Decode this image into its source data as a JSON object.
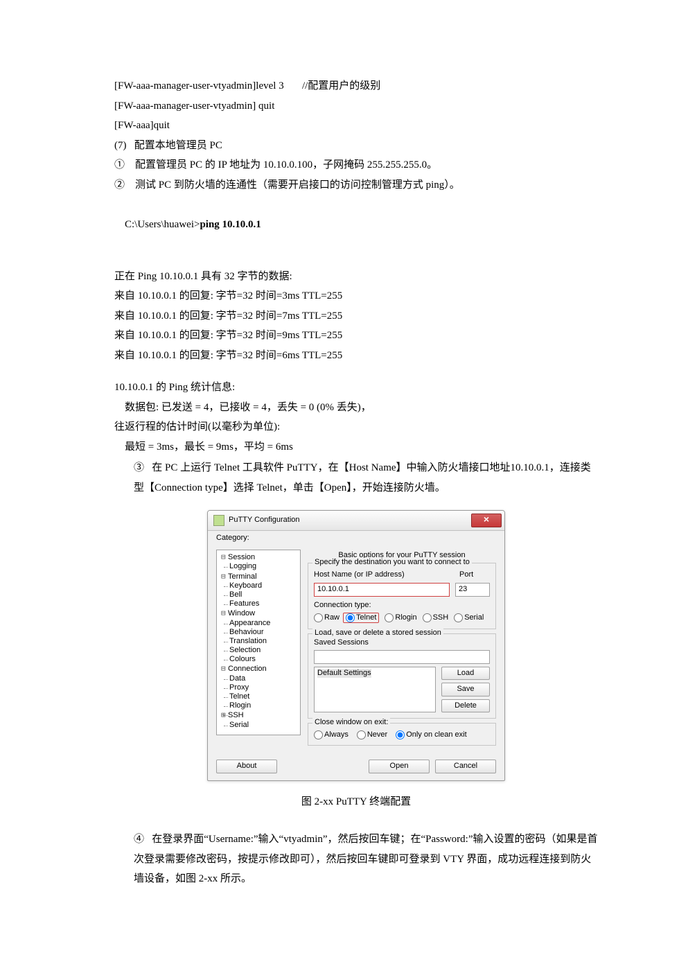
{
  "config_lines": {
    "l1": "[FW-aaa-manager-user-vtyadmin]level 3       //配置用户的级别",
    "l2": "[FW-aaa-manager-user-vtyadmin] quit",
    "l3": "[FW-aaa]quit"
  },
  "step7_heading": "(7)   配置本地管理员 PC",
  "step7_1": "①    配置管理员 PC 的 IP 地址为 10.10.0.100，子网掩码 255.255.255.0。",
  "step7_2": "②    测试 PC 到防火墙的连通性（需要开启接口的访问控制管理方式 ping）。",
  "ping_cmd_prefix": "C:\\Users\\huawei>",
  "ping_cmd_bold": "ping 10.10.0.1",
  "ping_block": {
    "hdr": "正在 Ping 10.10.0.1 具有 32 字节的数据:",
    "r1": "来自 10.10.0.1 的回复: 字节=32 时间=3ms TTL=255",
    "r2": "来自 10.10.0.1 的回复: 字节=32 时间=7ms TTL=255",
    "r3": "来自 10.10.0.1 的回复: 字节=32 时间=9ms TTL=255",
    "r4": "来自 10.10.0.1 的回复: 字节=32 时间=6ms TTL=255",
    "stats": "10.10.0.1 的 Ping 统计信息:",
    "pkts": "    数据包: 已发送 = 4，已接收 = 4，丢失 = 0 (0% 丢失)，",
    "rtt": "往返行程的估计时间(以毫秒为单位):",
    "times": "    最短 = 3ms，最长 = 9ms，平均 = 6ms"
  },
  "step7_3": "③   在 PC 上运行 Telnet 工具软件 PuTTY，在【Host Name】中输入防火墙接口地址10.10.0.1，连接类型【Connection type】选择 Telnet，单击【Open】，开始连接防火墙。",
  "putty": {
    "title": "PuTTY Configuration",
    "close": "×",
    "category_label": "Category:",
    "tree": {
      "session": "Session",
      "logging": "Logging",
      "terminal": "Terminal",
      "keyboard": "Keyboard",
      "bell": "Bell",
      "features": "Features",
      "window": "Window",
      "appearance": "Appearance",
      "behaviour": "Behaviour",
      "translation": "Translation",
      "selection": "Selection",
      "colours": "Colours",
      "connection": "Connection",
      "data": "Data",
      "proxy": "Proxy",
      "telnet": "Telnet",
      "rlogin": "Rlogin",
      "ssh": "SSH",
      "serial": "Serial"
    },
    "right": {
      "header": "Basic options for your PuTTY session",
      "dest_title": "Specify the destination you want to connect to",
      "host_label": "Host Name (or IP address)",
      "port_label": "Port",
      "host_val": "10.10.0.1",
      "port_val": "23",
      "conn_type_label": "Connection type:",
      "raw": "Raw",
      "telnet": "Telnet",
      "rlogin": "Rlogin",
      "ssh": "SSH",
      "serial": "Serial",
      "sessions_title": "Load, save or delete a stored session",
      "saved_sessions_label": "Saved Sessions",
      "default_settings": "Default Settings",
      "load": "Load",
      "save": "Save",
      "delete": "Delete",
      "close_title": "Close window on exit:",
      "always": "Always",
      "never": "Never",
      "clean": "Only on clean exit"
    },
    "footer": {
      "about": "About",
      "open": "Open",
      "cancel": "Cancel"
    }
  },
  "figure_caption": "图 2-xx PuTTY 终端配置",
  "step7_4": "④   在登录界面“Username:”输入“vtyadmin”，然后按回车键；在“Password:”输入设置的密码（如果是首次登录需要修改密码，按提示修改即可），然后按回车键即可登录到 VTY 界面，成功远程连接到防火墙设备，如图 2-xx 所示。"
}
